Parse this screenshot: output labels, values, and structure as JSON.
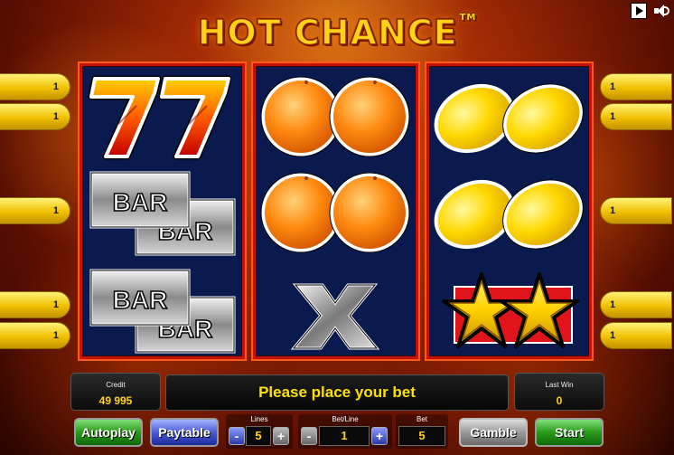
{
  "title": {
    "text": "HOT CHANCE",
    "tm": "TM"
  },
  "reels": [
    {
      "symbols": [
        "seven-seven",
        "bar-bar",
        "bar-bar"
      ]
    },
    {
      "symbols": [
        "oranges",
        "oranges",
        "x"
      ]
    },
    {
      "symbols": [
        "lemons",
        "lemons",
        "stars"
      ]
    }
  ],
  "symbol_text": {
    "bar": "BAR",
    "seven": "7"
  },
  "lines_left": [
    "1",
    "1",
    "1",
    "1",
    "1"
  ],
  "lines_right": [
    "1",
    "1",
    "1",
    "1",
    "1"
  ],
  "panel": {
    "credit_label": "Credit",
    "credit_value": "49 995",
    "message": "Please place your bet",
    "last_win_label": "Last Win",
    "last_win_value": "0"
  },
  "controls": {
    "autoplay": "Autoplay",
    "paytable": "Paytable",
    "lines_label": "Lines",
    "lines_value": "5",
    "betline_label": "Bet/Line",
    "betline_value": "1",
    "bet_label": "Bet",
    "bet_value": "5",
    "gamble": "Gamble",
    "start": "Start",
    "minus": "-",
    "plus": "+"
  },
  "colors": {
    "reel_bg": "#0b1a4e",
    "reel_border": "#c41208",
    "message": "#ffe100",
    "value": "#ffd21a"
  }
}
